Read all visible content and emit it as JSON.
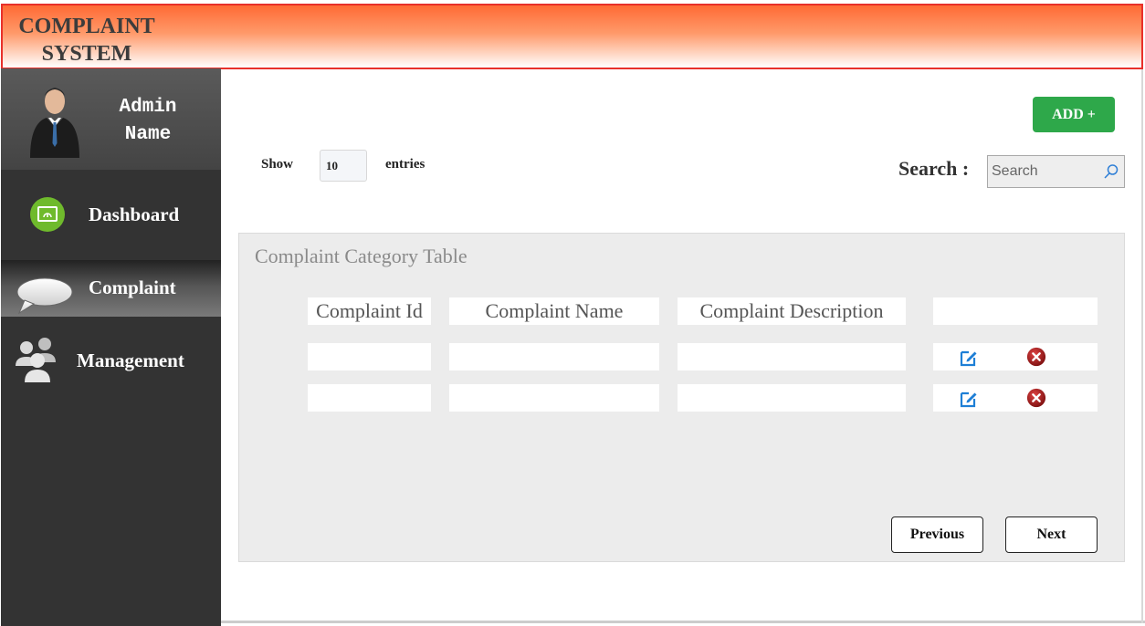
{
  "header": {
    "brand_line1": "COMPLAINT",
    "brand_line2": "SYSTEM"
  },
  "sidebar": {
    "profile": {
      "name_line1": "Admin",
      "name_line2": "Name"
    },
    "items": [
      {
        "label": "Dashboard",
        "icon": "dashboard-icon",
        "active": false
      },
      {
        "label": "Complaint",
        "icon": "speech-bubble-icon",
        "active": true
      },
      {
        "label": "Management",
        "icon": "users-icon",
        "active": false
      }
    ]
  },
  "toolbar": {
    "add_label": "ADD +",
    "show_label": "Show",
    "entries_value": "10",
    "entries_label": "entries",
    "search_label": "Search :",
    "search_placeholder": "Search"
  },
  "table": {
    "title": "Complaint Category Table",
    "columns": [
      "Complaint Id",
      "Complaint Name",
      "Complaint Description",
      ""
    ],
    "rows": [
      {
        "id": "",
        "name": "",
        "description": ""
      },
      {
        "id": "",
        "name": "",
        "description": ""
      }
    ]
  },
  "pagination": {
    "previous_label": "Previous",
    "next_label": "Next"
  },
  "colors": {
    "header_accent": "#ff6a35",
    "add_button": "#2ea84a",
    "sidebar_bg": "#333333",
    "edit_icon": "#1e7fd6",
    "delete_icon": "#b01e1e"
  }
}
